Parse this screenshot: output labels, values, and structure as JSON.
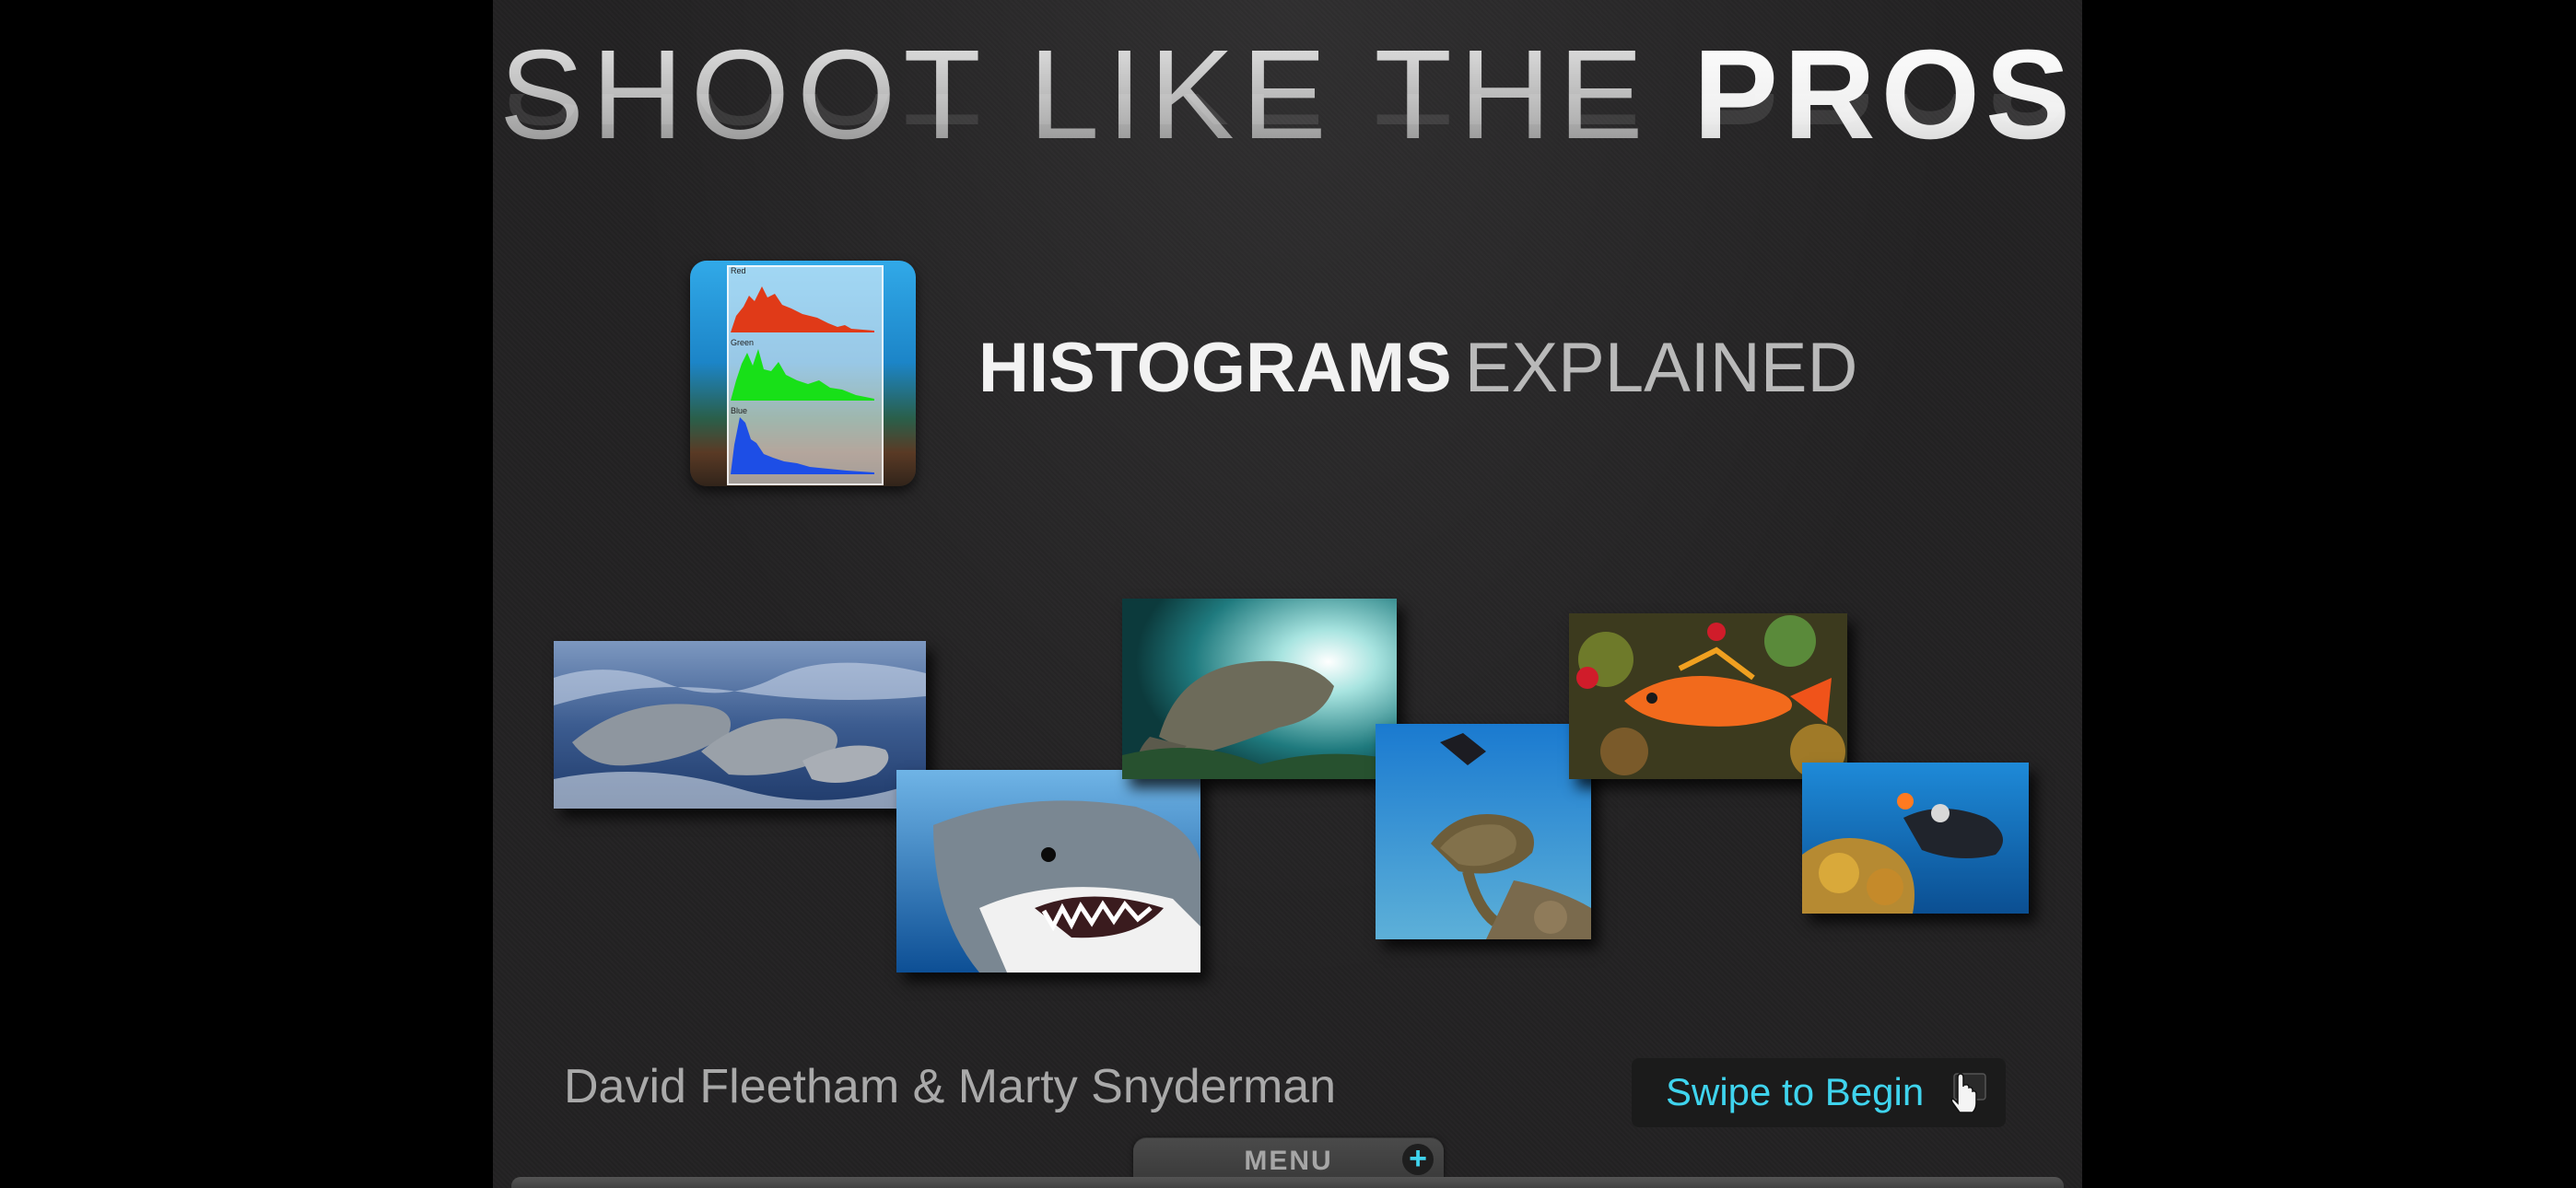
{
  "header": {
    "title_light": "SHOOT LIKE THE",
    "title_bold": "PROS"
  },
  "book": {
    "subtitle_bold": "HISTOGRAMS",
    "subtitle_light": "EXPLAINED",
    "icon_labels": [
      "Red",
      "Green",
      "Blue"
    ]
  },
  "footer": {
    "authors": "David Fleetham & Marty Snyderman",
    "swipe_label": "Swipe to Begin",
    "menu_label": "MENU",
    "menu_plus": "+"
  },
  "colors": {
    "accent": "#3fd4ee",
    "background": "#232223"
  },
  "photos": [
    "dolphins",
    "great-white-shark",
    "manatee",
    "diver-and-sea-turtle",
    "orange-reef-fish",
    "diver-with-light-on-reef"
  ]
}
